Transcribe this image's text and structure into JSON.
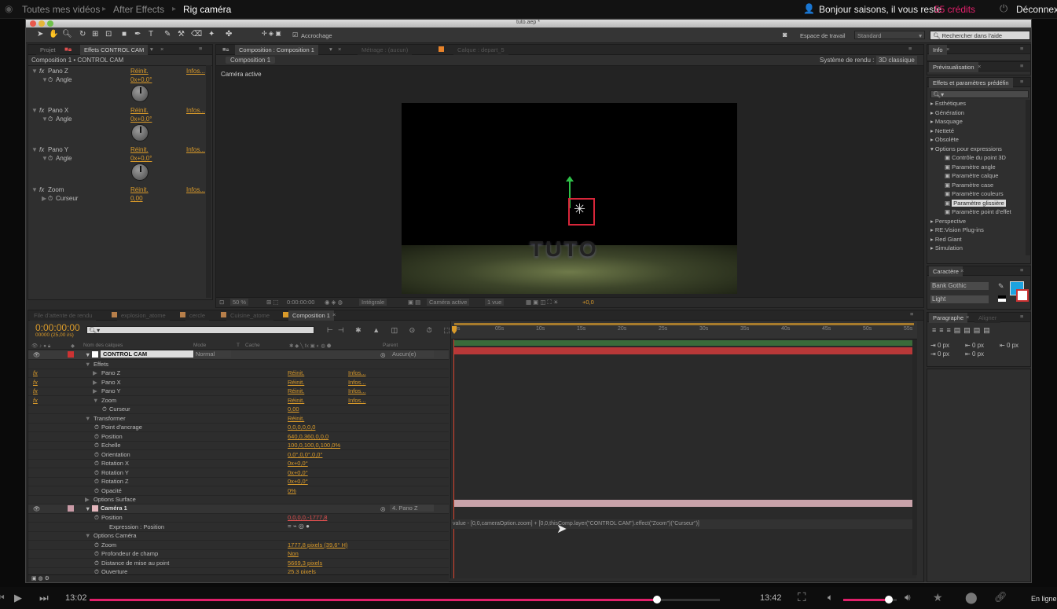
{
  "site": {
    "crumbs": [
      "Toutes mes vidéos",
      "After Effects",
      "Rig caméra"
    ],
    "greeting": "Bonjour saisons, il vous reste",
    "credits": "55 crédits",
    "logout": "Déconnexi"
  },
  "app": {
    "window_title": "tuto.aep *",
    "toolbar": {
      "snap_label": "Accrochage",
      "workspace_label": "Espace de travail",
      "workspace_value": "Standard",
      "search_placeholder": "Rechercher dans l'aide"
    }
  },
  "effects_panel": {
    "tabs": [
      "Projet",
      "Effets CONTROL CAM"
    ],
    "header": "Composition 1 • CONTROL CAM",
    "effects": [
      {
        "name": "Pano Z",
        "param": "Angle",
        "value": "0x+0,0°",
        "reset": "Réinit.",
        "about": "Infos..."
      },
      {
        "name": "Pano X",
        "param": "Angle",
        "value": "0x+0,0°",
        "reset": "Réinit.",
        "about": "Infos..."
      },
      {
        "name": "Pano Y",
        "param": "Angle",
        "value": "0x+0,0°",
        "reset": "Réinit.",
        "about": "Infos..."
      },
      {
        "name": "Zoom",
        "param": "Curseur",
        "value": "0,00",
        "reset": "Réinit.",
        "about": "Infos..."
      }
    ]
  },
  "comp_panel": {
    "tabs": [
      "Composition : Composition 1",
      "Métrage : (aucun)",
      "Calque : depart_5"
    ],
    "subtab": "Composition 1",
    "renderer_label": "Système de rendu :",
    "renderer_value": "3D classique",
    "view_label": "Caméra active",
    "viewport_text": "TUTO",
    "footer": {
      "zoom": "50 %",
      "timecode": "0:00:00:00",
      "resolution": "Intégrale",
      "camera": "Caméra active",
      "views": "1 vue",
      "exposure": "+0,0"
    }
  },
  "right_panels": {
    "info_tab": "Info",
    "preview_tab": "Prévisualisation",
    "effects_tab": "Effets et paramètres prédéfin",
    "tree": [
      {
        "label": "Esthétiques",
        "level": 0
      },
      {
        "label": "Génération",
        "level": 0
      },
      {
        "label": "Masquage",
        "level": 0
      },
      {
        "label": "Netteté",
        "level": 0
      },
      {
        "label": "Obsolète",
        "level": 0
      },
      {
        "label": "Options pour expressions",
        "level": 0,
        "open": true
      },
      {
        "label": "Contrôle du point 3D",
        "level": 1
      },
      {
        "label": "Paramètre angle",
        "level": 1
      },
      {
        "label": "Paramètre calque",
        "level": 1
      },
      {
        "label": "Paramètre case",
        "level": 1
      },
      {
        "label": "Paramètre couleurs",
        "level": 1
      },
      {
        "label": "Paramètre glissière",
        "level": 1,
        "selected": true
      },
      {
        "label": "Paramètre point d'effet",
        "level": 1
      },
      {
        "label": "Perspective",
        "level": 0
      },
      {
        "label": "RE:Vision Plug-ins",
        "level": 0
      },
      {
        "label": "Red Giant",
        "level": 0
      },
      {
        "label": "Simulation",
        "level": 0
      }
    ],
    "character_tab": "Caractère",
    "font_family": "Bank Gothic",
    "font_style": "Light",
    "paragraph_tab": "Paragraphe",
    "align_tab": "Aligner",
    "para_values": [
      "0 px",
      "0 px",
      "0 px",
      "0 px",
      "0 px"
    ],
    "accent_color": "#1ea3e0"
  },
  "timeline": {
    "tabs": [
      "File d'attente de rendu",
      "explosion_atome",
      "cercle",
      "Cuisine_atome",
      "Composition 1"
    ],
    "timecode": "0:00:00:00",
    "frame_info": "00000 (25,00 i/s)",
    "col_headers": {
      "layer_name": "Nom des calques",
      "mode": "Mode",
      "t": "T",
      "mask": "Cache",
      "parent": "Parent"
    },
    "ruler": [
      "0s",
      "05s",
      "10s",
      "15s",
      "20s",
      "25s",
      "30s",
      "35s",
      "40s",
      "45s",
      "50s",
      "55s"
    ],
    "rows": [
      {
        "indent": 0,
        "label": "CONTROL CAM",
        "kind": "layer",
        "num": "1",
        "mode": "Normal",
        "parent": "Aucun(e)"
      },
      {
        "indent": 1,
        "label": "Effets",
        "kind": "group"
      },
      {
        "indent": 2,
        "label": "Pano Z",
        "kind": "fx",
        "v1": "Réinit.",
        "v2": "Infos..."
      },
      {
        "indent": 2,
        "label": "Pano X",
        "kind": "fx",
        "v1": "Réinit.",
        "v2": "Infos..."
      },
      {
        "indent": 2,
        "label": "Pano Y",
        "kind": "fx",
        "v1": "Réinit.",
        "v2": "Infos..."
      },
      {
        "indent": 2,
        "label": "Zoom",
        "kind": "fx",
        "v1": "Réinit.",
        "v2": "Infos..."
      },
      {
        "indent": 3,
        "label": "Curseur",
        "kind": "prop",
        "v1": "0,00"
      },
      {
        "indent": 1,
        "label": "Transformer",
        "kind": "group",
        "v1": "Réinit."
      },
      {
        "indent": 2,
        "label": "Point d'ancrage",
        "kind": "prop",
        "v1": "0,0,0,0,0,0"
      },
      {
        "indent": 2,
        "label": "Position",
        "kind": "prop",
        "v1": "640,0,360,0,0,0"
      },
      {
        "indent": 2,
        "label": "Echelle",
        "kind": "prop",
        "v1": "100,0,100,0,100,0%"
      },
      {
        "indent": 2,
        "label": "Orientation",
        "kind": "prop",
        "v1": "0,0°,0,0°,0,0°"
      },
      {
        "indent": 2,
        "label": "Rotation X",
        "kind": "prop",
        "v1": "0x+0,0°"
      },
      {
        "indent": 2,
        "label": "Rotation Y",
        "kind": "prop",
        "v1": "0x+0,0°"
      },
      {
        "indent": 2,
        "label": "Rotation Z",
        "kind": "prop",
        "v1": "0x+0,0°"
      },
      {
        "indent": 2,
        "label": "Opacité",
        "kind": "prop",
        "v1": "0%"
      },
      {
        "indent": 1,
        "label": "Options Surface",
        "kind": "group"
      },
      {
        "indent": 0,
        "label": "Caméra 1",
        "kind": "camera",
        "num": "2",
        "parent": "4. Pano Z"
      },
      {
        "indent": 2,
        "label": "Position",
        "kind": "prop",
        "v1": "0,0,0,0,-1777,8",
        "red": true
      },
      {
        "indent": 3,
        "label": "Expression : Position",
        "kind": "expr"
      },
      {
        "indent": 1,
        "label": "Options Caméra",
        "kind": "group"
      },
      {
        "indent": 2,
        "label": "Zoom",
        "kind": "prop",
        "v1": "1777,8 pixels (39,6° H)"
      },
      {
        "indent": 2,
        "label": "Profondeur de champ",
        "kind": "prop",
        "v1": "Non"
      },
      {
        "indent": 2,
        "label": "Distance de mise au point",
        "kind": "prop",
        "v1": "5669,3 pixels"
      },
      {
        "indent": 2,
        "label": "Ouverture",
        "kind": "prop",
        "v1": "25,3 pixels"
      }
    ],
    "expression": "value - [0,0,cameraOption.zoom] + [0,0,thisComp.layer(\"CONTROL CAM\").effect(\"Zoom\")(\"Curseur\")]"
  },
  "player": {
    "current_time": "13:02",
    "total_time": "13:42",
    "progress": 0.9,
    "volume": 0.85,
    "status": "En ligne",
    "accent": "#e0206a"
  }
}
